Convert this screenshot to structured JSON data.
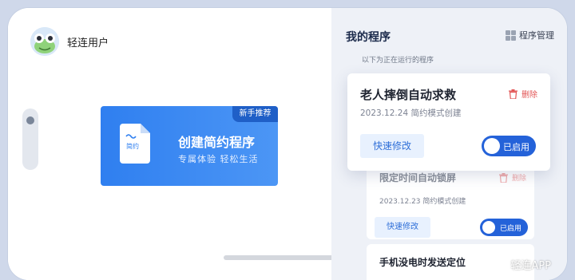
{
  "user": {
    "name": "轻连用户"
  },
  "promo": {
    "badge": "新手推荐",
    "doc_label": "简约",
    "title": "创建简约程序",
    "subtitle": "专属体验 轻松生活"
  },
  "panel": {
    "title": "我的程序",
    "manage_label": "程序管理",
    "hint": "以下为正在运行的程序"
  },
  "programs": [
    {
      "name": "老人摔倒自动求救",
      "date": "2023.12.24 简约模式创建",
      "delete_label": "删除",
      "edit_label": "快速修改",
      "status": "已启用"
    },
    {
      "name": "限定时间自动锁屏",
      "date": "2023.12.23 简约模式创建",
      "delete_label": "删除",
      "edit_label": "快速修改",
      "status": "已启用"
    },
    {
      "name": "手机没电时发送定位"
    }
  ],
  "watermark": "轻连APP",
  "colors": {
    "accent": "#2462d9",
    "danger": "#e25454",
    "panel_bg": "#eef1f7"
  }
}
